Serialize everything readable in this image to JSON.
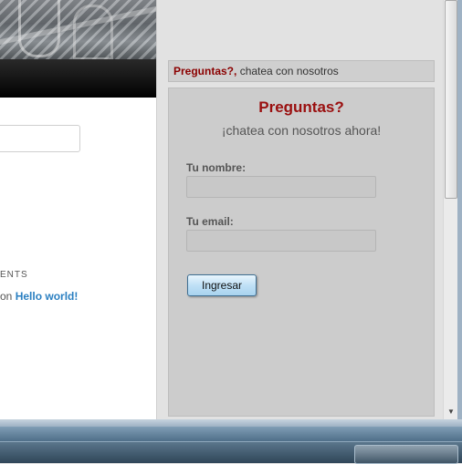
{
  "blog": {
    "comments_heading": "ENTS",
    "comment_prefix": "on",
    "comment_link": "Hello world!"
  },
  "chat": {
    "header_strong": "Preguntas?,",
    "header_rest": " chatea con nosotros",
    "title": "Preguntas?",
    "subtitle": "¡chatea con nosotros ahora!",
    "name_label": "Tu nombre:",
    "name_value": "",
    "email_label": "Tu email:",
    "email_value": "",
    "submit_label": "Ingresar"
  },
  "colors": {
    "accent_red": "#9a0f0f",
    "link_blue": "#2a7fc1"
  }
}
